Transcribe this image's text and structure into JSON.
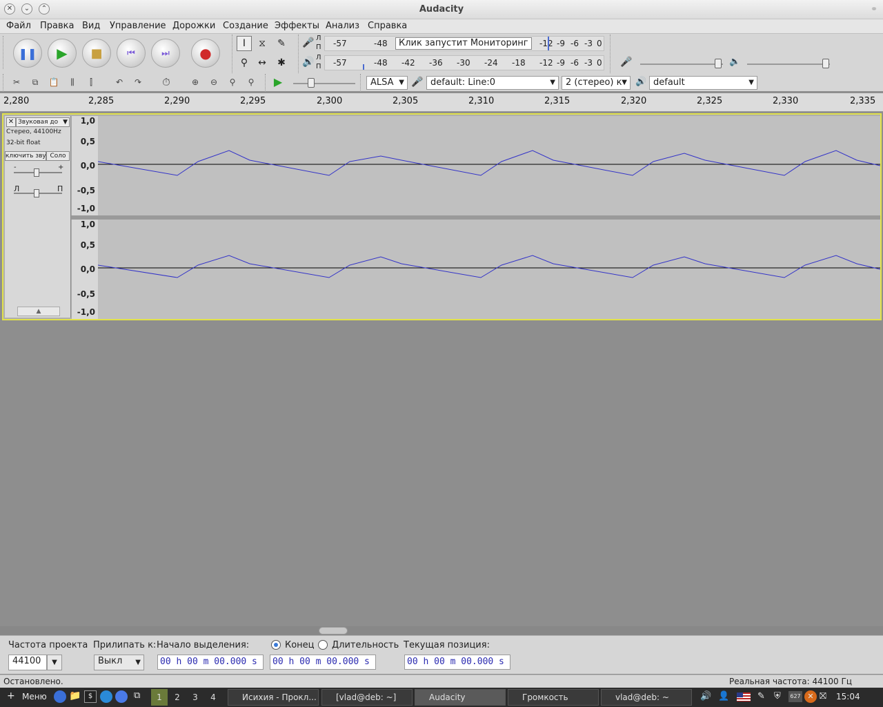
{
  "window": {
    "title": "Audacity"
  },
  "menu": [
    "Файл",
    "Правка",
    "Вид",
    "Управление",
    "Дорожки",
    "Создание",
    "Эффекты",
    "Анализ",
    "Справка"
  ],
  "meter": {
    "rec_l": "Л",
    "rec_r": "П",
    "rec_ticks": [
      "-57",
      "-48",
      "-12",
      "-9",
      "-6",
      "-3",
      "0"
    ],
    "monitor_label": "Клик запустит Мониторинг",
    "play_ticks": [
      "-57",
      "-48",
      "-42",
      "-36",
      "-30",
      "-24",
      "-18",
      "-12",
      "-9",
      "-6",
      "-3",
      "0"
    ]
  },
  "device": {
    "host": "ALSA",
    "input": "default: Line:0",
    "channels": "2 (стерео) к",
    "output": "default"
  },
  "ruler": [
    "2,280",
    "2,285",
    "2,290",
    "2,295",
    "2,300",
    "2,305",
    "2,310",
    "2,315",
    "2,320",
    "2,325",
    "2,330",
    "2,335"
  ],
  "track": {
    "name": "Звуковая до",
    "info1": "Стерео, 44100Hz",
    "info2": "32-bit float",
    "mute": "ключить звук",
    "solo": "Соло",
    "gain_minus": "-",
    "gain_plus": "+",
    "pan_l": "Л",
    "pan_r": "П",
    "scale": [
      "1,0",
      "0,5",
      "0,0",
      "-0,5",
      "-1,0"
    ]
  },
  "selection": {
    "rate_label": "Частота проекта",
    "rate_value": "44100",
    "snap_label": "Прилипать к:",
    "snap_value": "Выкл",
    "start_label": "Начало выделения:",
    "end_label": "Конец",
    "length_label": "Длительность",
    "pos_label": "Текущая позиция:",
    "time_value": "00 h 00 m 00.000 s"
  },
  "status": {
    "left": "Остановлено.",
    "right": "Реальная частота: 44100 Гц"
  },
  "taskbar": {
    "menu": "Меню",
    "workspaces": [
      "1",
      "2",
      "3",
      "4"
    ],
    "tasks": [
      "Исихия - Прокл...",
      "[vlad@deb: ~]",
      "Audacity",
      "Громкость",
      "vlad@deb: ~"
    ],
    "cpu": "627",
    "clock": "15:04"
  }
}
